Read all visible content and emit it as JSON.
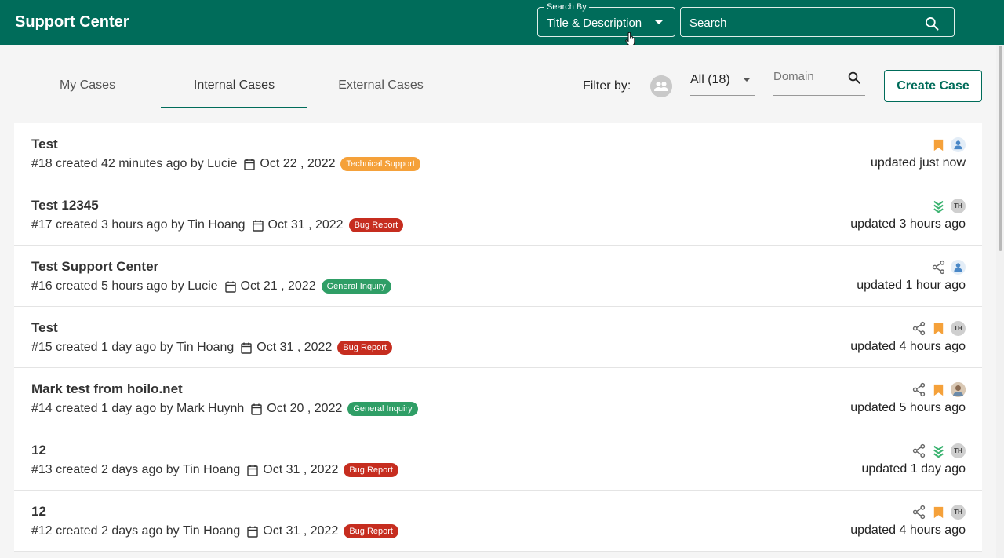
{
  "header": {
    "brand": "Support Center",
    "search_by_legend": "Search By",
    "search_by_value": "Title & Description",
    "search_placeholder": "Search"
  },
  "tabs": [
    {
      "label": "My Cases",
      "active": false
    },
    {
      "label": "Internal Cases",
      "active": true
    },
    {
      "label": "External Cases",
      "active": false
    }
  ],
  "filters": {
    "label": "Filter by:",
    "assignee_value": "All (18)",
    "domain_placeholder": "Domain"
  },
  "create_button": "Create Case",
  "badge_colors": {
    "Technical Support": "#f5a13a",
    "Bug Report": "#c62d1f",
    "General Inquiry": "#2f9e66"
  },
  "cases": [
    {
      "title": "Test",
      "id": "#18",
      "created": "created 42 minutes ago by",
      "author": "Lucie",
      "date": "Oct 22 , 2022",
      "tag": "Technical Support",
      "updated": "updated just now",
      "icons": [
        "bookmark",
        "avatar-user"
      ]
    },
    {
      "title": "Test 12345",
      "id": "#17",
      "created": "created 3 hours ago by",
      "author": "Tin Hoang",
      "date": "Oct 31 , 2022",
      "tag": "Bug Report",
      "updated": "updated 3 hours ago",
      "icons": [
        "priority-low",
        "avatar-th"
      ]
    },
    {
      "title": "Test Support Center",
      "id": "#16",
      "created": "created 5 hours ago by",
      "author": "Lucie",
      "date": "Oct 21 , 2022",
      "tag": "General Inquiry",
      "updated": "updated 1 hour ago",
      "icons": [
        "share",
        "avatar-user"
      ]
    },
    {
      "title": "Test",
      "id": "#15",
      "created": "created 1 day ago by",
      "author": "Tin Hoang",
      "date": "Oct 31 , 2022",
      "tag": "Bug Report",
      "updated": "updated 4 hours ago",
      "icons": [
        "share",
        "bookmark",
        "avatar-th"
      ]
    },
    {
      "title": "Mark test from hoilo.net",
      "id": "#14",
      "created": "created 1 day ago by",
      "author": "Mark Huynh",
      "date": "Oct 20 , 2022",
      "tag": "General Inquiry",
      "updated": "updated 5 hours ago",
      "icons": [
        "share",
        "bookmark",
        "avatar-photo"
      ]
    },
    {
      "title": "12",
      "id": "#13",
      "created": "created 2 days ago by",
      "author": "Tin Hoang",
      "date": "Oct 31 , 2022",
      "tag": "Bug Report",
      "updated": "updated 1 day ago",
      "icons": [
        "share",
        "priority-low",
        "avatar-th"
      ]
    },
    {
      "title": "12",
      "id": "#12",
      "created": "created 2 days ago by",
      "author": "Tin Hoang",
      "date": "Oct 31 , 2022",
      "tag": "Bug Report",
      "updated": "updated 4 hours ago",
      "icons": [
        "share",
        "bookmark",
        "avatar-th"
      ]
    }
  ]
}
